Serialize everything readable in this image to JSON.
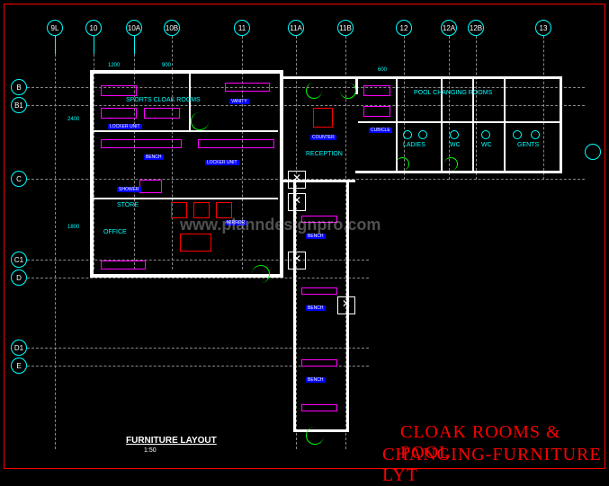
{
  "drawing": {
    "title_line1": "CLOAK ROOMS & POOL",
    "title_line2": "CHANGING-FURNITURE LYT",
    "scale_label": "FURNITURE LAYOUT",
    "scale_value": "1:50",
    "watermark": "www.planndesignpro.com"
  },
  "grid": {
    "columns": [
      "9L",
      "10",
      "10A",
      "10B",
      "11",
      "11A",
      "11B",
      "12",
      "12A",
      "12B",
      "13"
    ],
    "rows": [
      "B",
      "B1",
      "C",
      "C1",
      "D",
      "D1",
      "E"
    ]
  },
  "rooms": {
    "sports_cloak": "SPORTS CLOAK ROOMS",
    "pool_changing": "POOL CHANGING ROOMS",
    "reception": "RECEPTION",
    "ladies": "LADIES",
    "gents": "GENTS",
    "wc1": "WC",
    "wc2": "WC",
    "store": "STORE",
    "office": "OFFICE"
  },
  "notes": {
    "n1": "LOCKER UNIT",
    "n2": "BENCH",
    "n3": "SHOWER",
    "n4": "COUNTER",
    "n5": "CUBICLE",
    "n6": "MIRROR",
    "n7": "VANITY"
  },
  "dims": {
    "d1": "1200",
    "d2": "900",
    "d3": "2400",
    "d4": "600",
    "d5": "1800"
  }
}
